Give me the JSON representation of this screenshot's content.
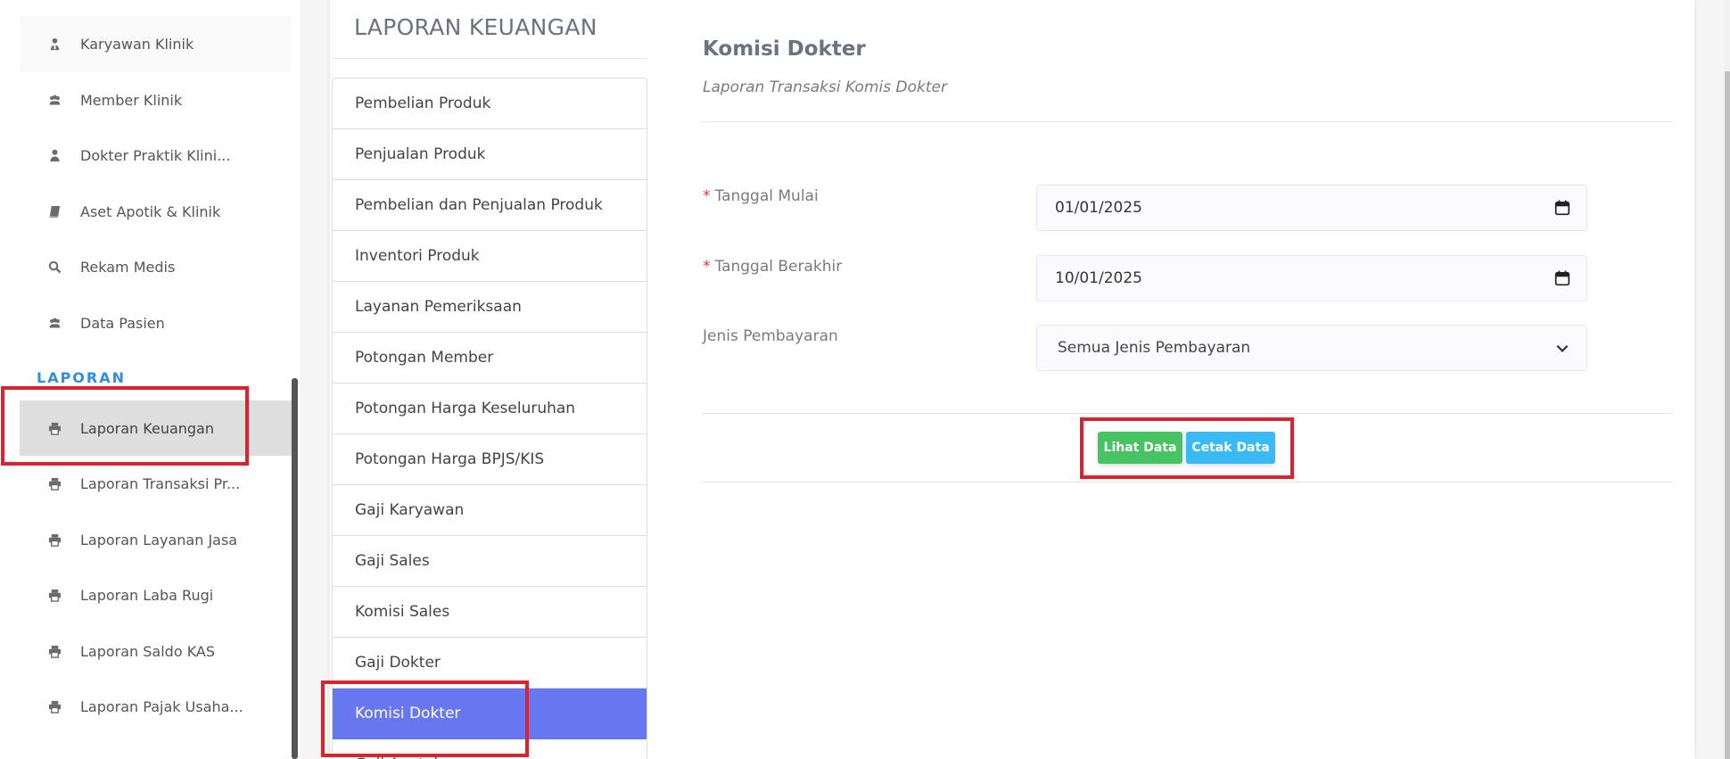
{
  "sidebar": {
    "items_top": [
      {
        "label": "Karyawan Klinik",
        "icon": "user-tie-icon"
      },
      {
        "label": "Member Klinik",
        "icon": "users-icon"
      },
      {
        "label": "Dokter Praktik Klini...",
        "icon": "user-icon"
      },
      {
        "label": "Aset Apotik & Klinik",
        "icon": "book-icon"
      },
      {
        "label": "Rekam Medis",
        "icon": "search-icon"
      },
      {
        "label": "Data Pasien",
        "icon": "users-icon"
      }
    ],
    "section_label": "LAPORAN",
    "items_laporan": [
      {
        "label": "Laporan Keuangan",
        "icon": "print-icon"
      },
      {
        "label": "Laporan Transaksi Pr...",
        "icon": "print-icon"
      },
      {
        "label": "Laporan Layanan Jasa",
        "icon": "print-icon"
      },
      {
        "label": "Laporan Laba Rugi",
        "icon": "print-icon"
      },
      {
        "label": "Laporan Saldo KAS",
        "icon": "print-icon"
      },
      {
        "label": "Laporan Pajak Usaha...",
        "icon": "print-icon"
      }
    ]
  },
  "card": {
    "title": "LAPORAN KEUANGAN"
  },
  "report_list": [
    "Pembelian Produk",
    "Penjualan Produk",
    "Pembelian dan Penjualan Produk",
    "Inventori Produk",
    "Layanan Pemeriksaan",
    "Potongan Member",
    "Potongan Harga Keseluruhan",
    "Potongan Harga BPJS/KIS",
    "Gaji Karyawan",
    "Gaji Sales",
    "Komisi Sales",
    "Gaji Dokter",
    "Komisi Dokter",
    "Gaji Apoteker"
  ],
  "active_report": "Komisi Dokter",
  "form": {
    "title": "Komisi Dokter",
    "subtitle": "Laporan Transaksi Komis Dokter",
    "required_mark": "*",
    "start_date_label": "Tanggal Mulai",
    "start_date_value": "01/01/2025",
    "end_date_label": "Tanggal Berakhir",
    "end_date_value": "10/01/2025",
    "payment_type_label": "Jenis Pembayaran",
    "payment_type_value": "Semua Jenis Pembayaran",
    "view_button": "Lihat Data",
    "print_button": "Cetak Data"
  },
  "colors": {
    "accent": "#6777ef",
    "success": "#47c363",
    "info": "#3abaf4",
    "highlight": "#d9232d",
    "section": "#2d8fe0"
  }
}
